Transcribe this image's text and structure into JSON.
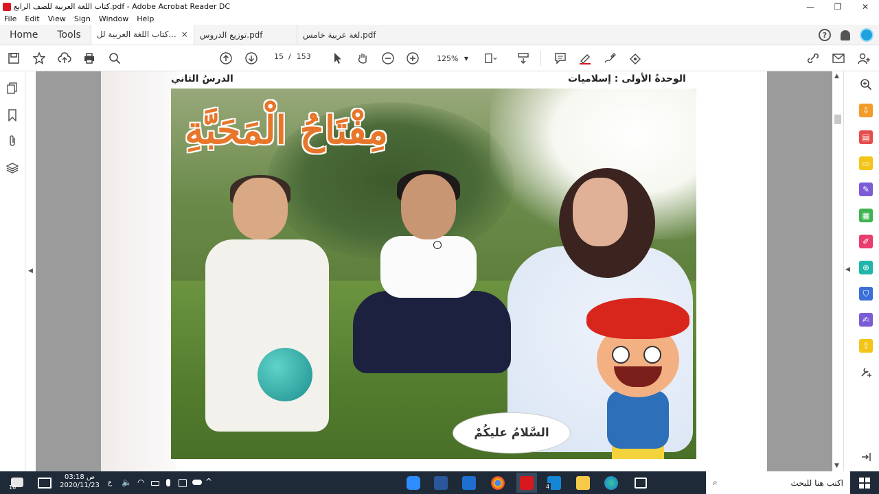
{
  "window": {
    "title": "كتاب اللغة العربية للصف الرابع.pdf - Adobe Acrobat Reader DC",
    "minimize": "—",
    "maximize": "❐",
    "close": "✕"
  },
  "menu": [
    "File",
    "Edit",
    "View",
    "Sign",
    "Window",
    "Help"
  ],
  "nav_tabs": {
    "home": "Home",
    "tools": "Tools"
  },
  "doc_tabs": [
    {
      "label": "كتاب اللغة العربية لل...",
      "close": "×",
      "active": true
    },
    {
      "label": "توزيع الدروس.pdf",
      "active": false
    },
    {
      "label": "لغة عربية خامس.pdf",
      "active": false
    }
  ],
  "toolbar": {
    "page_current": "15",
    "page_separator": "/",
    "page_total": "153",
    "zoom": "125%"
  },
  "document": {
    "header_right": "الوحدةُ الأولى : إسلاميات",
    "header_left": "الدرسُ الثاني",
    "title": "مِفْتَاحُ الْمَحَبَّةِ",
    "speech_bubble": "السَّلامُ عليكُمْ"
  },
  "taskbar": {
    "time": "03:18 ص",
    "date": "2020/11/23",
    "lang": "ع",
    "search_placeholder": "اكتب هنا للبحث",
    "notif_count": "16",
    "mail_badge": "4"
  },
  "icons": {
    "left_panel": [
      "pages-icon",
      "bookmark-icon",
      "attachment-icon",
      "layers-icon"
    ],
    "right_panel": [
      "zoom-icon",
      "export-pdf-icon",
      "organize-icon",
      "comment-icon",
      "edit-pdf-icon",
      "compress-icon",
      "fill-sign-icon",
      "create-pdf-icon",
      "protect-icon",
      "sign-icon",
      "send-icon",
      "more-tools-icon",
      "expand-icon"
    ]
  },
  "colors": {
    "accent_orange": "#e7762a",
    "acrobat_red": "#d7191f",
    "taskbar": "#1f2a38"
  }
}
